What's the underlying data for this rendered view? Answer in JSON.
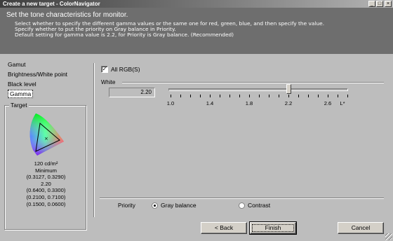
{
  "window": {
    "title": "Create a new target - ColorNavigator",
    "controls": {
      "minimize": "_",
      "maximize": "□",
      "close": "×"
    }
  },
  "header": {
    "heading": "Set the tone characteristics for monitor.",
    "lines": [
      "Select whether to specify the different gamma values or the same one for red, green, blue, and then specify the value.",
      "Specify whether to put the priority on Gray balance in Priority.",
      "Default setting for gamma value is 2.2, for Priority is Gray balance. (Recommended)"
    ]
  },
  "nav": {
    "items": [
      {
        "label": "Gamut",
        "active": false
      },
      {
        "label": "Brightness/White point",
        "active": false
      },
      {
        "label": "Black level",
        "active": false
      },
      {
        "label": "Gamma",
        "active": true
      }
    ]
  },
  "target": {
    "title": "Target",
    "lines": [
      "120 cd/m²",
      "Minimum",
      "(0.3127, 0.3290)",
      "2.20",
      "(0.6400, 0.3300)",
      "(0.2100, 0.7100)",
      "(0.1500, 0.0600)"
    ]
  },
  "gamma": {
    "all_rgb_label": "All RGB(S)",
    "all_rgb_checked": true,
    "channel_label": "White",
    "value": "2.20",
    "slider_min": 1.0,
    "slider_max": 2.8,
    "slider_value": 2.2,
    "tick_labels": [
      "1.0",
      "1.4",
      "1.8",
      "2.2",
      "2.6",
      "L*"
    ]
  },
  "priority": {
    "label": "Priority",
    "options": [
      {
        "label": "Gray balance",
        "selected": true
      },
      {
        "label": "Contrast",
        "selected": false
      }
    ]
  },
  "buttons": {
    "back": "< Back",
    "finish": "Finish",
    "cancel": "Cancel"
  },
  "colors": {
    "header_bg": "#6e6e6e",
    "window_bg": "#bdbdbd"
  }
}
